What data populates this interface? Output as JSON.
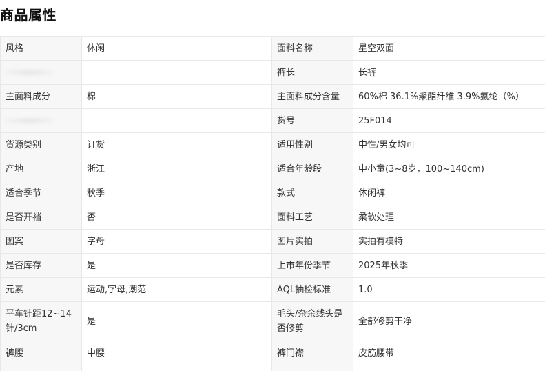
{
  "title": "商品属性",
  "rows": [
    {
      "k1": "风格",
      "v1": "休闲",
      "k2": "面料名称",
      "v2": "星空双面"
    },
    {
      "k1": "",
      "v1": "",
      "k2": "裤长",
      "v2": "长裤"
    },
    {
      "k1": "主面料成分",
      "v1": "棉",
      "k2": "主面料成分含量",
      "v2": "60%棉 36.1%聚酯纤维 3.9%氨纶（%）"
    },
    {
      "k1": "",
      "v1": "",
      "k2": "货号",
      "v2": "25F014"
    },
    {
      "k1": "货源类别",
      "v1": "订货",
      "k2": "适用性别",
      "v2": "中性/男女均可"
    },
    {
      "k1": "产地",
      "v1": "浙江",
      "k2": "适合年龄段",
      "v2": "中小童(3~8岁，100~140cm)"
    },
    {
      "k1": "适合季节",
      "v1": "秋季",
      "k2": "款式",
      "v2": "休闲裤"
    },
    {
      "k1": "是否开裆",
      "v1": "否",
      "k2": "面料工艺",
      "v2": "柔软处理"
    },
    {
      "k1": "图案",
      "v1": "字母",
      "k2": "图片实拍",
      "v2": "实拍有模特"
    },
    {
      "k1": "是否库存",
      "v1": "是",
      "k2": "上市年份季节",
      "v2": "2025年秋季"
    },
    {
      "k1": "元素",
      "v1": "运动,字母,潮范",
      "k2": "AQL抽检标准",
      "v2": "1.0"
    },
    {
      "k1": "平车针距12~14针/3cm",
      "v1": "是",
      "k2": "毛头/杂余线头是否修剪",
      "v2": "全部修剪干净"
    },
    {
      "k1": "裤腰",
      "v1": "中腰",
      "k2": "裤门襟",
      "v2": "皮筋腰带"
    }
  ]
}
